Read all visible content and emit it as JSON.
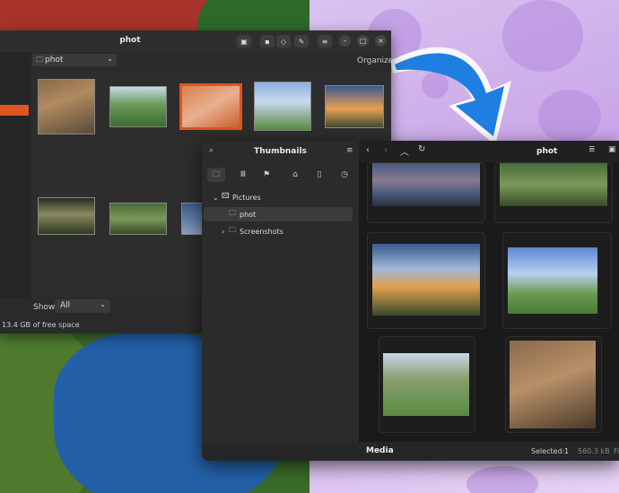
{
  "window_back": {
    "title": "phot",
    "folder": "phot",
    "organize": "Organize",
    "show_label": "Show:",
    "show_value": "All",
    "free_space": "13.4 GB of free space"
  },
  "window_front": {
    "sidebar_title": "Thumbnails",
    "tree": [
      "Pictures",
      "phot",
      "Screenshots"
    ],
    "title": "phot",
    "status_label": "Media",
    "selected_label": "Selected:",
    "selected_count": "1",
    "selected_size": "560.3 kB",
    "truncated": "Fi"
  },
  "colors": {
    "accent": "#e0541f",
    "arrow": "#1f7fe0"
  }
}
